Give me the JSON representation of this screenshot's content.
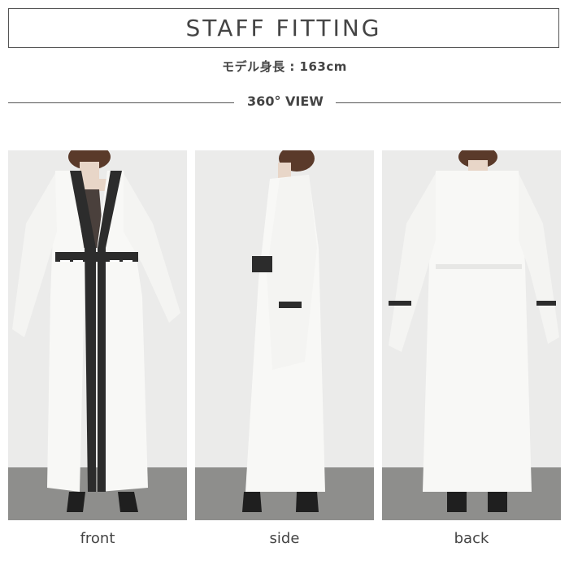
{
  "header": {
    "title": "STAFF FITTING",
    "model_height": "モデル身長 : 163cm",
    "view_label": "360° VIEW"
  },
  "photos": [
    {
      "caption": "front"
    },
    {
      "caption": "side"
    },
    {
      "caption": "back"
    }
  ],
  "colors": {
    "wall": "#ebebea",
    "floor": "#8e8e8c",
    "garment": "#f8f8f6",
    "lace": "#2c2c2c",
    "hair": "#5a3a2a",
    "camisole": "#4a403c"
  }
}
